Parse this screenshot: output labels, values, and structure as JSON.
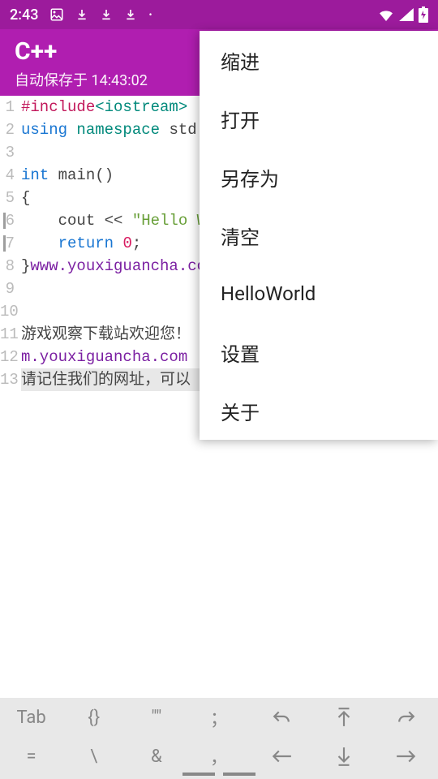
{
  "status": {
    "time": "2:43",
    "icons": [
      "image",
      "download",
      "download",
      "download",
      "dot"
    ],
    "right_icons": [
      "wifi",
      "signal",
      "battery"
    ]
  },
  "appbar": {
    "title": "C++",
    "subtitle": "自动保存于 14:43:02"
  },
  "menu": {
    "items": [
      "缩进",
      "打开",
      "另存为",
      "清空",
      "HelloWorld",
      "设置",
      "关于"
    ]
  },
  "code": {
    "lines": [
      {
        "n": "1",
        "segs": [
          {
            "c": "kw-pre",
            "t": "#include"
          },
          {
            "c": "kw-inc",
            "t": "<iostream>"
          }
        ]
      },
      {
        "n": "2",
        "segs": [
          {
            "c": "kw-blue",
            "t": "using "
          },
          {
            "c": "kw-teal",
            "t": "namespace "
          },
          {
            "c": "kw-txt",
            "t": "std;"
          }
        ]
      },
      {
        "n": "3",
        "segs": []
      },
      {
        "n": "4",
        "segs": [
          {
            "c": "kw-blue",
            "t": "int "
          },
          {
            "c": "kw-txt",
            "t": "main()"
          }
        ]
      },
      {
        "n": "5",
        "segs": [
          {
            "c": "kw-txt",
            "t": "{"
          }
        ]
      },
      {
        "n": "6",
        "segs": [
          {
            "c": "kw-txt",
            "t": "    cout << "
          },
          {
            "c": "kw-str",
            "t": "\"Hello World\""
          }
        ]
      },
      {
        "n": "7",
        "segs": [
          {
            "c": "kw-txt",
            "t": "    "
          },
          {
            "c": "kw-blue",
            "t": "return "
          },
          {
            "c": "kw-num",
            "t": "0"
          },
          {
            "c": "kw-txt",
            "t": ";"
          }
        ]
      },
      {
        "n": "8",
        "segs": [
          {
            "c": "kw-txt",
            "t": "}"
          },
          {
            "c": "kw-url",
            "t": "www.youxiguancha.com"
          }
        ]
      },
      {
        "n": "9",
        "segs": []
      },
      {
        "n": "10",
        "segs": []
      },
      {
        "n": "11",
        "segs": [
          {
            "c": "kw-txt",
            "t": "游戏观察下载站欢迎您！"
          }
        ]
      },
      {
        "n": "12",
        "segs": [
          {
            "c": "kw-url",
            "t": "m.youxiguancha.com"
          }
        ]
      },
      {
        "n": "13",
        "hl": true,
        "segs": [
          {
            "c": "kw-txt",
            "t": "请记住我们的网址，可以"
          }
        ]
      }
    ]
  },
  "toolbar": {
    "row1": [
      "Tab",
      "{}",
      "\"\"",
      "；",
      "undo",
      "up",
      "redo"
    ],
    "row2": [
      "=",
      "\\",
      "&",
      "，",
      "left",
      "down",
      "right"
    ]
  }
}
